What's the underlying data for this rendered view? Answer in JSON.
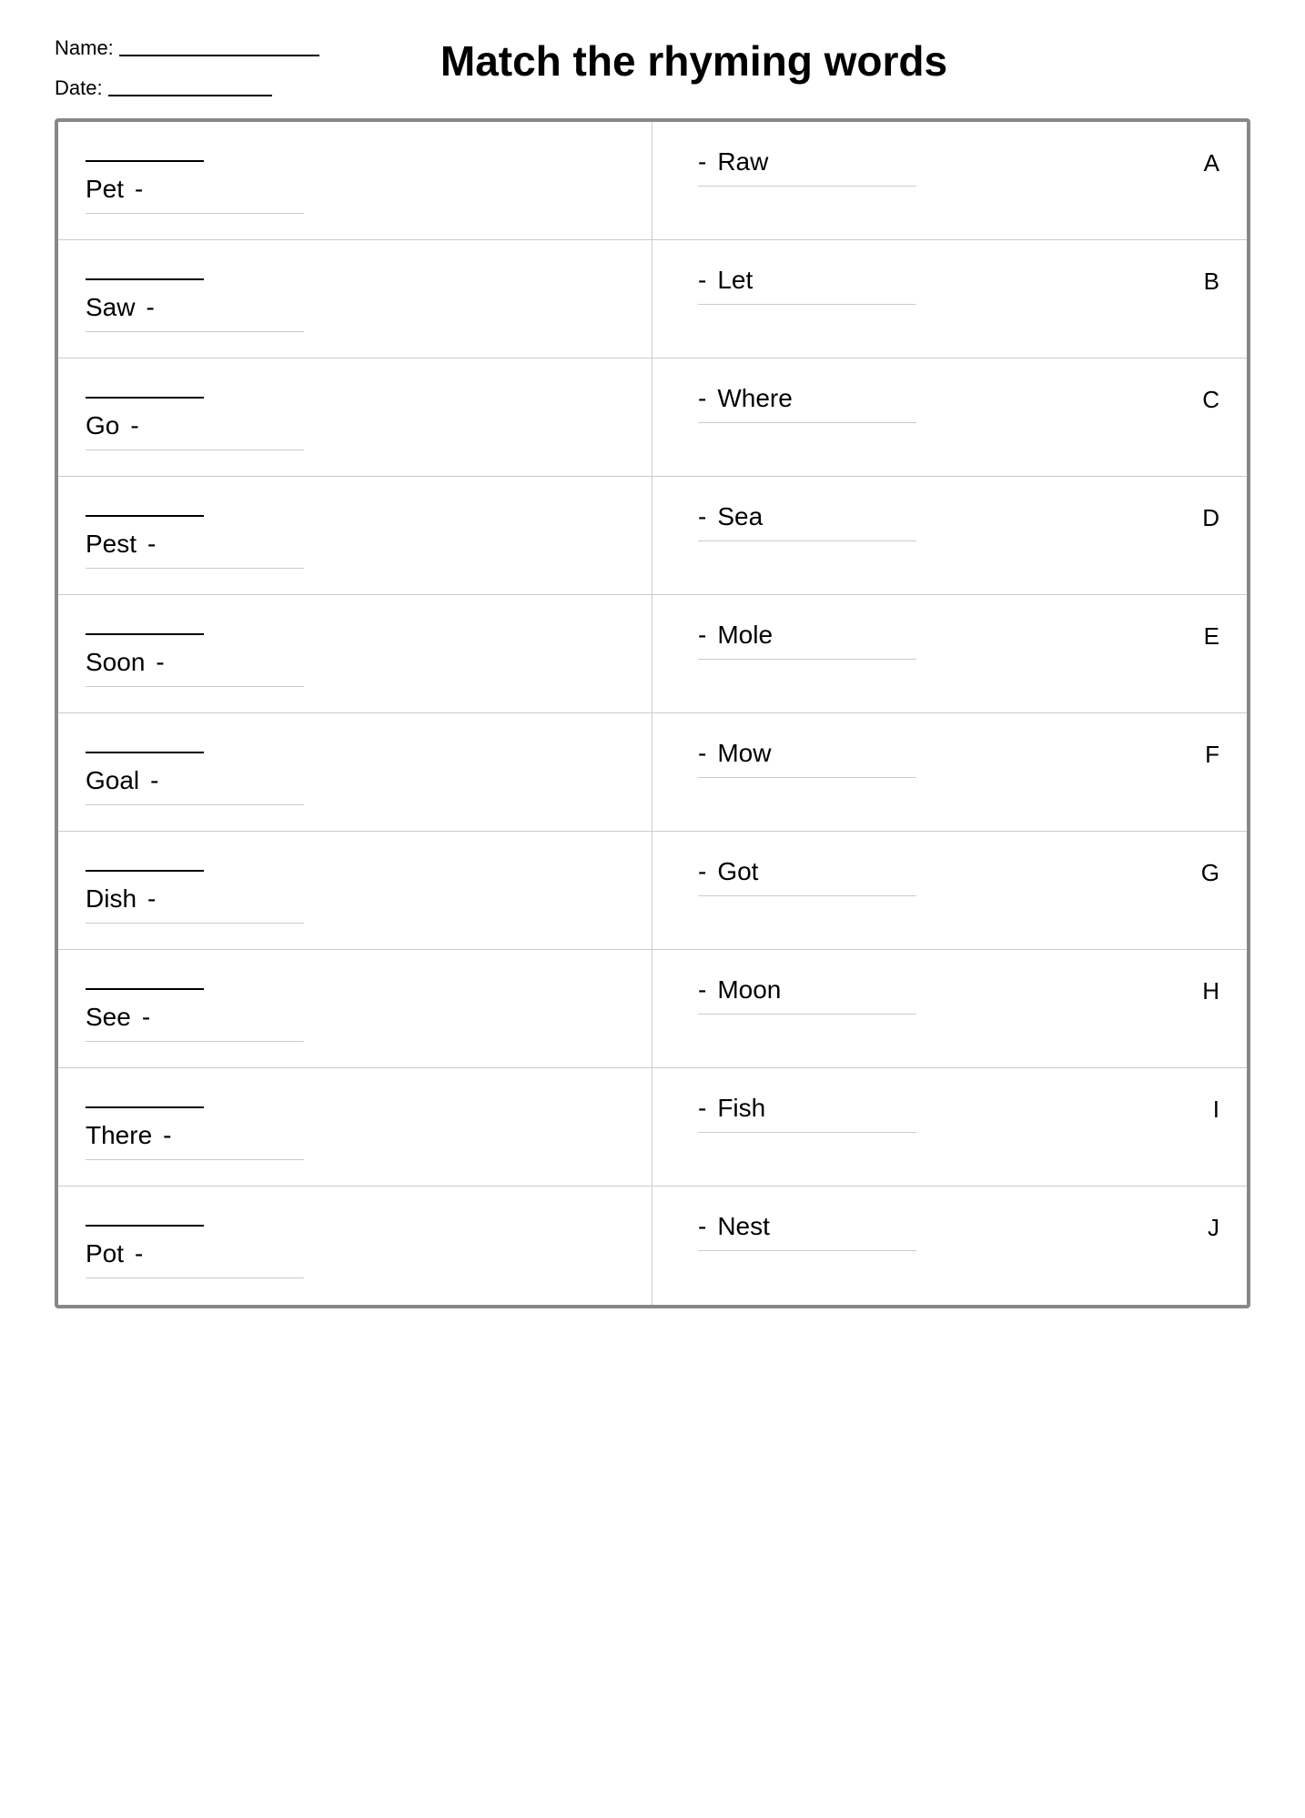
{
  "header": {
    "name_label": "Name:",
    "date_label": "Date:",
    "title": "Match the rhyming words"
  },
  "rows": [
    {
      "left_word": "Pet",
      "right_word": "Raw",
      "letter": "A"
    },
    {
      "left_word": "Saw",
      "right_word": "Let",
      "letter": "B"
    },
    {
      "left_word": "Go",
      "right_word": "Where",
      "letter": "C"
    },
    {
      "left_word": "Pest",
      "right_word": "Sea",
      "letter": "D"
    },
    {
      "left_word": "Soon",
      "right_word": "Mole",
      "letter": "E"
    },
    {
      "left_word": "Goal",
      "right_word": "Mow",
      "letter": "F"
    },
    {
      "left_word": "Dish",
      "right_word": "Got",
      "letter": "G"
    },
    {
      "left_word": "See",
      "right_word": "Moon",
      "letter": "H"
    },
    {
      "left_word": "There",
      "right_word": "Fish",
      "letter": "I"
    },
    {
      "left_word": "Pot",
      "right_word": "Nest",
      "letter": "J"
    }
  ]
}
